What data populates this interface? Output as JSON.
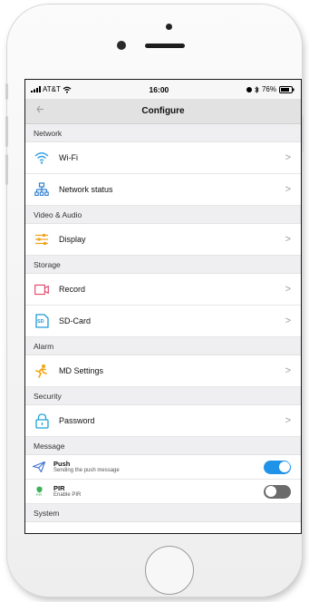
{
  "status_bar": {
    "carrier": "AT&T",
    "time": "16:00",
    "battery": "76%"
  },
  "nav": {
    "title": "Configure",
    "back_icon": "back-arrow-icon"
  },
  "sections": {
    "network": "Network",
    "video_audio": "Video & Audio",
    "storage": "Storage",
    "alarm": "Alarm",
    "security": "Security",
    "message": "Message",
    "system": "System"
  },
  "items": {
    "wifi": {
      "label": "Wi-Fi",
      "icon": "wifi-icon"
    },
    "network_status": {
      "label": "Network status",
      "icon": "network-tree-icon"
    },
    "display": {
      "label": "Display",
      "icon": "sliders-icon"
    },
    "record": {
      "label": "Record",
      "icon": "video-camera-icon"
    },
    "sd_card": {
      "label": "SD-Card",
      "icon": "sd-card-icon",
      "icon_text": "SD"
    },
    "md_settings": {
      "label": "MD Settings",
      "icon": "motion-detect-icon"
    },
    "password": {
      "label": "Password",
      "icon": "lock-icon"
    }
  },
  "toggles": {
    "push": {
      "title": "Push",
      "subtitle": "Sending the push message",
      "on": true,
      "icon": "paper-plane-icon"
    },
    "pir": {
      "title": "PIR",
      "subtitle": "Enable PIR",
      "on": false,
      "icon": "pir-sensor-icon",
      "icon_text": "PIR"
    }
  },
  "colors": {
    "wifi": "#3aa3e3",
    "network": "#2f7fcf",
    "display": "#f0a31c",
    "record": "#e14a6b",
    "sd": "#1f9ad6",
    "md": "#f3a512",
    "lock": "#1fa2d8",
    "push": "#3f6fd2",
    "pir": "#3bb25a",
    "toggle_on": "#1f93e8",
    "toggle_off": "#6b6b6b"
  }
}
